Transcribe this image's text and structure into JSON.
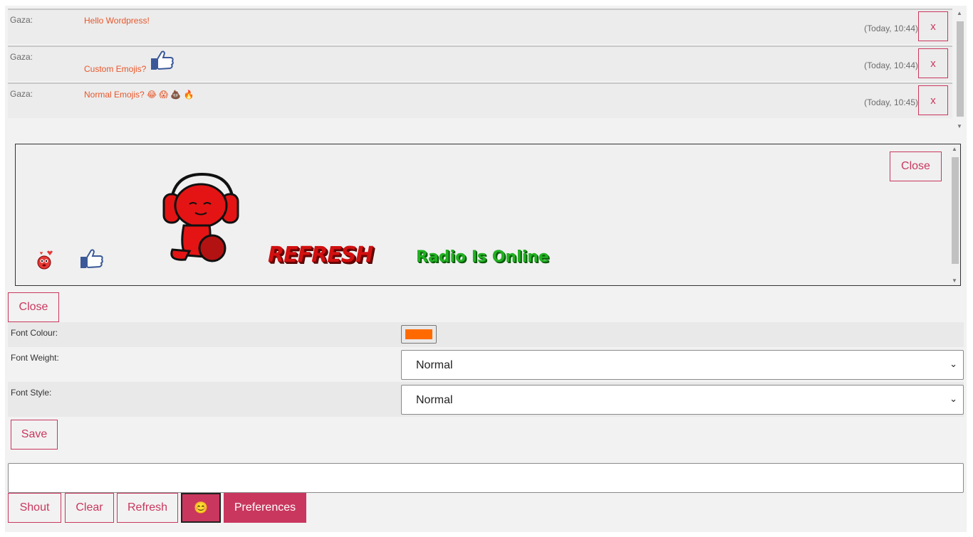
{
  "messages": [
    {
      "user": "Gaza:",
      "text": "Hello Wordpress!",
      "time": "(Today, 10:44)",
      "delete_label": "x"
    },
    {
      "user": "Gaza:",
      "text": "Custom Emojis?",
      "time": "(Today, 10:44)",
      "delete_label": "x"
    },
    {
      "user": "Gaza:",
      "text": "Normal Emojis? 😂 😱 💩 🔥",
      "time": "(Today, 10:45)",
      "delete_label": "x"
    }
  ],
  "emoji_panel": {
    "close_label": "Close",
    "banner_word": "REFRESH",
    "banner_status": "Radio Is Online"
  },
  "preferences": {
    "close_label": "Close",
    "font_colour_label": "Font Colour:",
    "font_colour_value": "#ff6a00",
    "font_weight_label": "Font Weight:",
    "font_weight_value": "Normal",
    "font_style_label": "Font Style:",
    "font_style_value": "Normal",
    "save_label": "Save"
  },
  "composer": {
    "input_value": "",
    "shout_label": "Shout",
    "clear_label": "Clear",
    "refresh_label": "Refresh",
    "emoji_label": "😊",
    "preferences_label": "Preferences"
  },
  "colors": {
    "accent": "#c9375e",
    "message_text": "#e8562a",
    "banner_red": "#d21010",
    "banner_green": "#22b022"
  }
}
